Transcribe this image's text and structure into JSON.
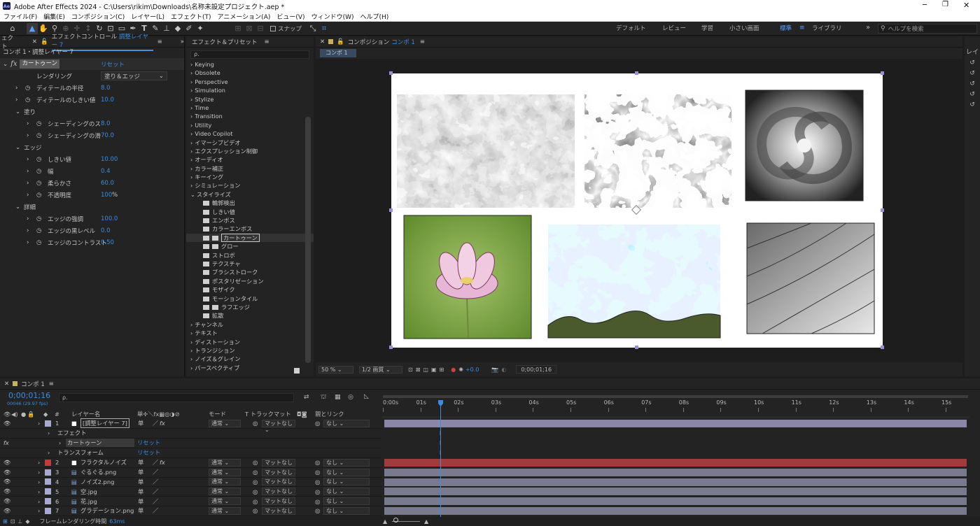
{
  "window": {
    "title": "Adobe After Effects 2024 - C:\\Users\\rikim\\Downloads\\名称未設定プロジェクト.aep *",
    "app_icon": "Ae"
  },
  "menu": [
    "ファイル(F)",
    "編集(E)",
    "コンポジション(C)",
    "レイヤー(L)",
    "エフェクト(T)",
    "アニメーション(A)",
    "ビュー(V)",
    "ウィンドウ(W)",
    "ヘルプ(H)"
  ],
  "toolbar": {
    "snap_label": "スナップ",
    "workspaces": [
      "デフォルト",
      "レビュー",
      "学習",
      "小さい画面",
      "標準",
      "ライブラリ"
    ],
    "active_workspace": "標準",
    "help_search_placeholder": "ヘルプを検索"
  },
  "effect_controls": {
    "tab_left": "ェクト",
    "tab_label": "エフェクトコントロール",
    "tab_layer": "調整レイヤー 7",
    "breadcrumb": "コンポ 1・調整レイヤー 7",
    "effect_name": "カートゥーン",
    "reset_label": "リセット",
    "rendering_label": "レンダリング",
    "rendering_value": "塗り＆エッジ",
    "props": [
      {
        "label": "ディテールの半径",
        "value": "8.0",
        "indent": 1
      },
      {
        "label": "ディテールのしきい値",
        "value": "10.0",
        "indent": 1
      },
      {
        "label": "塗り",
        "value": "",
        "indent": 0,
        "group": true
      },
      {
        "label": "シェーディングのス",
        "value": "8.0",
        "indent": 2
      },
      {
        "label": "シェーディングの滑",
        "value": "70.0",
        "indent": 2
      },
      {
        "label": "エッジ",
        "value": "",
        "indent": 0,
        "group": true
      },
      {
        "label": "しきい値",
        "value": "10.00",
        "indent": 2
      },
      {
        "label": "幅",
        "value": "0.4",
        "indent": 2
      },
      {
        "label": "柔らかさ",
        "value": "60.0",
        "indent": 2
      },
      {
        "label": "不透明度",
        "value": "100",
        "unit": "%",
        "indent": 2
      },
      {
        "label": "詳細",
        "value": "",
        "indent": 0,
        "group": true
      },
      {
        "label": "エッジの強調",
        "value": "100.0",
        "indent": 2
      },
      {
        "label": "エッジの黒レベル",
        "value": "0.0",
        "indent": 2
      },
      {
        "label": "エッジのコントラスト",
        "value": "0.50",
        "indent": 2
      }
    ]
  },
  "effects_presets": {
    "title": "エフェクト＆プリセット",
    "search_placeholder": "ρ.",
    "categories": [
      "Keying",
      "Obsolete",
      "Perspective",
      "Simulation",
      "Stylize",
      "Time",
      "Transition",
      "Utility",
      "Video Copilot",
      "イマーシブビデオ",
      "エクスプレッション制御",
      "オーディオ",
      "カラー補正",
      "キーイング",
      "シミュレーション"
    ],
    "expanded_category": "スタイライズ",
    "stylize_items": [
      "輪郭検出",
      "しきい値",
      "エンボス",
      "カラーエンボス",
      "カートゥーン",
      "グロー",
      "ストロボ",
      "テクスチャ",
      "ブラシストローク",
      "ポスタリゼーション",
      "モザイク",
      "モーションタイル",
      "ラフエッジ",
      "拡散"
    ],
    "selected_item": "カートゥーン",
    "after_categories": [
      "チャンネル",
      "テキスト",
      "ディストーション",
      "トランジション",
      "ノイズ＆グレイン",
      "パースペクティブ"
    ]
  },
  "composition": {
    "tab_prefix": "コンポジション",
    "tab_name": "コンポ 1",
    "sub_tab": "コンポ 1",
    "zoom": "50 %",
    "resolution": "1/2 画質",
    "exposure": "+0.0",
    "timecode": "0;00;01;16"
  },
  "timeline": {
    "tab": "コンポ 1",
    "timecode": "0;00;01;16",
    "frame_info": "00046 (29.97 fps)",
    "search_placeholder": "ρ.",
    "col_layer_name": "レイヤー名",
    "col_mode": "モード",
    "col_track": "T  トラックマット",
    "col_parent": "親とリンク",
    "ruler": [
      "0:00s",
      "01s",
      "02s",
      "03s",
      "04s",
      "05s",
      "06s",
      "07s",
      "08s",
      "09s",
      "10s",
      "11s",
      "12s",
      "13s",
      "14s",
      "15s"
    ],
    "current_time_sec": 1.53,
    "sub_effect": "エフェクト",
    "sub_effect_name": "カートゥーン",
    "sub_transform": "トランスフォーム",
    "reset_label": "リセット",
    "layers": [
      {
        "num": "1",
        "name": "[調整レイヤー 7]",
        "label_color": "#a8a8d0",
        "mode": "通常",
        "track": "マットなし",
        "parent": "なし",
        "bar_color": "#8a86a8",
        "fx": true
      },
      {
        "num": "2",
        "name": "フラクタルノイズ",
        "label_color": "#c23a3a",
        "mode": "通常",
        "track": "マットなし",
        "parent": "なし",
        "bar_color": "#a03c3c",
        "fx": true
      },
      {
        "num": "3",
        "name": "ぐるぐる.png",
        "label_color": "#a8a8d0",
        "mode": "通常",
        "track": "マットなし",
        "parent": "なし",
        "bar_color": "#7a7a8e"
      },
      {
        "num": "4",
        "name": "ノイズ2.png",
        "label_color": "#a8a8d0",
        "mode": "通常",
        "track": "マットなし",
        "parent": "なし",
        "bar_color": "#7a7a8e"
      },
      {
        "num": "5",
        "name": "空.jpg",
        "label_color": "#a8a8d0",
        "mode": "通常",
        "track": "マットなし",
        "parent": "なし",
        "bar_color": "#7a7a8e"
      },
      {
        "num": "6",
        "name": "花.jpg",
        "label_color": "#a8a8d0",
        "mode": "通常",
        "track": "マットなし",
        "parent": "なし",
        "bar_color": "#7a7a8e"
      },
      {
        "num": "7",
        "name": "グラデーション.png",
        "label_color": "#a8a8d0",
        "mode": "通常",
        "track": "マットなし",
        "parent": "なし",
        "bar_color": "#7a7a8e"
      }
    ],
    "render_time_label": "フレームレンダリング時間",
    "render_time_value": "63ms"
  }
}
